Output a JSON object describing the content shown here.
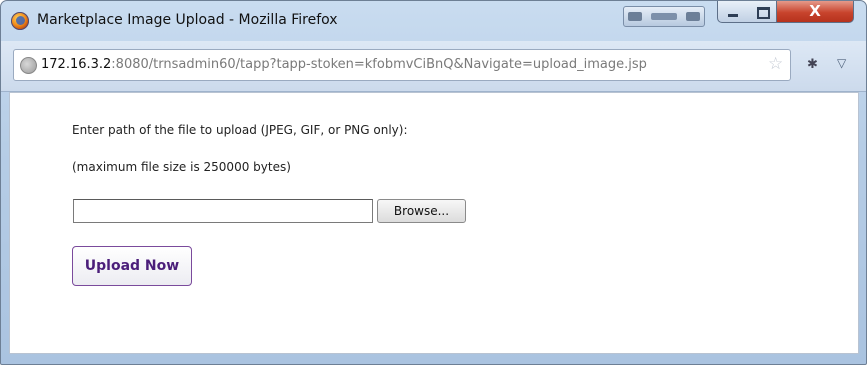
{
  "window": {
    "title": "Marketplace Image Upload - Mozilla Firefox",
    "close_symbol": "X"
  },
  "urlbar": {
    "host": "172.16.3.2",
    "path": ":8080/trnsadmin60/tapp?tapp-stoken=kfobmvCiBnQ&Navigate=upload_image.jsp"
  },
  "form": {
    "instruction": "Enter path of the file to upload (JPEG, GIF, or PNG only):",
    "size_note": "(maximum file size is 250000 bytes)",
    "file_value": "",
    "browse_label": "Browse...",
    "upload_label": "Upload Now"
  },
  "icons": {
    "app": "firefox-icon",
    "site": "globe-icon",
    "bookmark": "star-icon",
    "addon": "addon-icon",
    "menu": "dropdown-arrow-icon"
  },
  "colors": {
    "upload_text": "#4b1e7a",
    "upload_border": "#7a4a9c",
    "close_button": "#c8442d"
  }
}
